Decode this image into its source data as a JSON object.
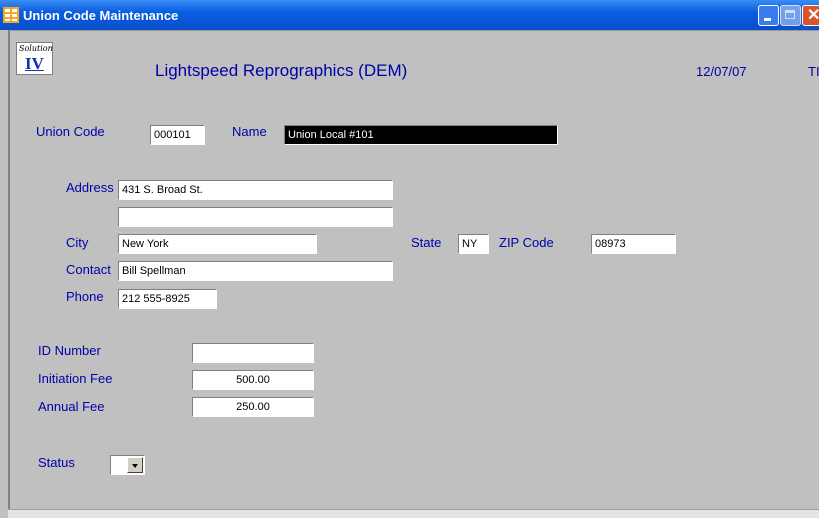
{
  "window": {
    "title": "Union Code Maintenance"
  },
  "header": {
    "logo_script": "Solution",
    "logo_mark": "IV",
    "company": "Lightspeed Reprographics (DEM)",
    "date": "12/07/07",
    "truncated_text": "TI"
  },
  "form": {
    "union_code": {
      "label": "Union Code",
      "value": "000101"
    },
    "name": {
      "label": "Name",
      "value": "Union Local #101"
    },
    "address": {
      "label": "Address",
      "line1": "431 S. Broad St.",
      "line2": ""
    },
    "city": {
      "label": "City",
      "value": "New York"
    },
    "state": {
      "label": "State",
      "value": "NY"
    },
    "zip": {
      "label": "ZIP Code",
      "value": "08973"
    },
    "contact": {
      "label": "Contact",
      "value": "Bill Spellman"
    },
    "phone": {
      "label": "Phone",
      "value": "212 555-8925"
    },
    "id_number": {
      "label": "ID Number",
      "value": ""
    },
    "initiation_fee": {
      "label": "Initiation Fee",
      "value": "500.00"
    },
    "annual_fee": {
      "label": "Annual Fee",
      "value": "250.00"
    },
    "status": {
      "label": "Status",
      "value": ""
    }
  }
}
